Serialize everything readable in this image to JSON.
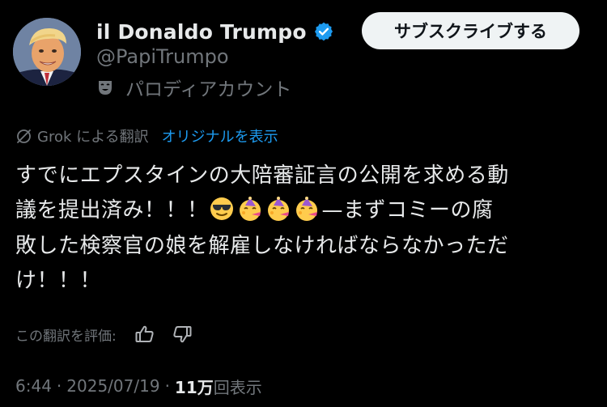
{
  "profile": {
    "display_name": "il Donaldo Trumpo",
    "handle": "@PapiTrumpo",
    "parody_label": "パロディアカウント",
    "verified_color": "#1d9bf0"
  },
  "subscribe_button": {
    "label": "サブスクライブする"
  },
  "translation": {
    "translated_by": "Grok による翻訳",
    "show_original": "オリジナルを表示",
    "link_color": "#1d9bf0"
  },
  "post": {
    "line1": "すでにエプスタインの大陪審証言の公開を求める動",
    "line2_prefix": "議を提出済み！！！",
    "line2_suffix": "—まずコミーの腐",
    "line3": "敗した検察官の娘を解雇しなければならなかっただ",
    "line4": "け！！！",
    "emojis": [
      "smiling-face-with-sunglasses",
      "partying-face",
      "partying-face",
      "partying-face"
    ]
  },
  "rating": {
    "label": "この翻訳を評価:"
  },
  "meta": {
    "time": "6:44",
    "separator": "·",
    "date": "2025/07/19",
    "view_count": "11万",
    "views_label": "回表示"
  }
}
